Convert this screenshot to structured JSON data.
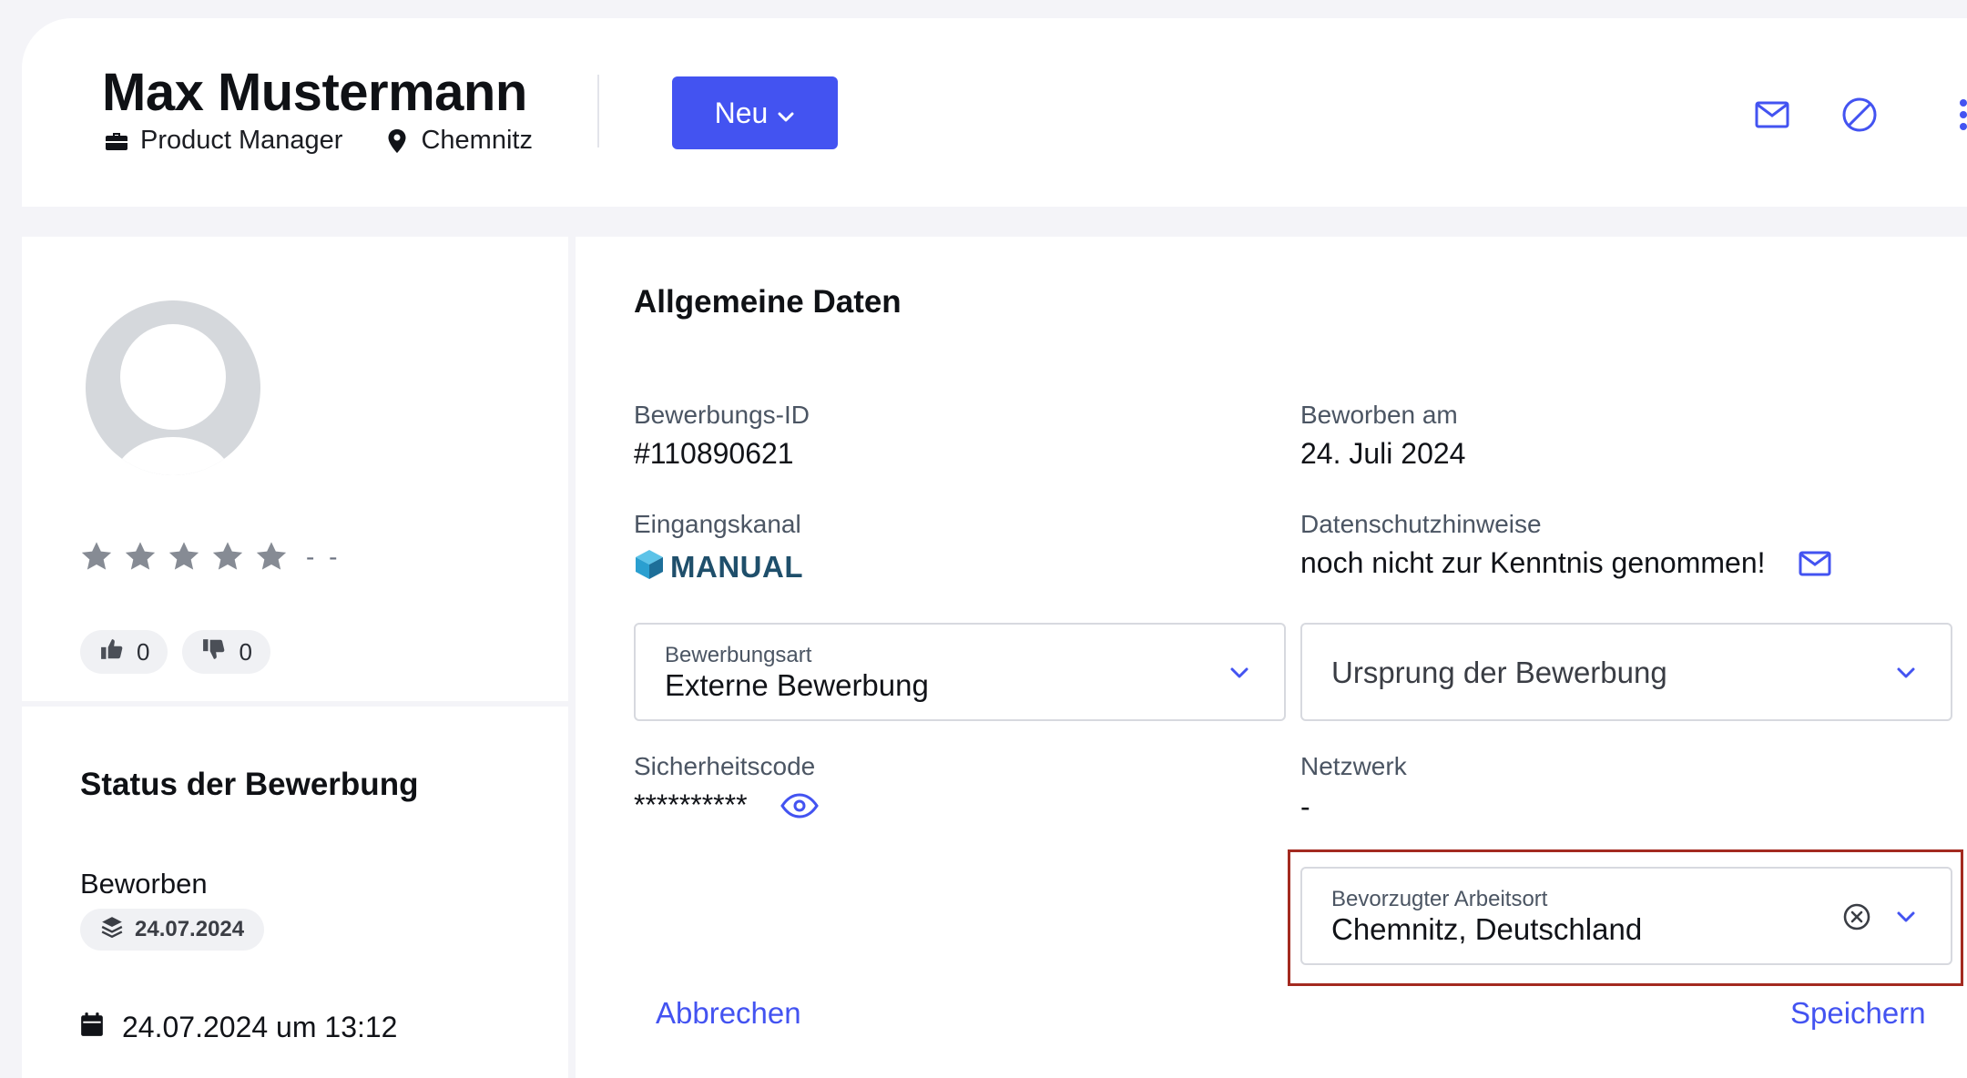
{
  "header": {
    "name": "Max Mustermann",
    "job_title": "Product Manager",
    "location": "Chemnitz",
    "new_button_label": "Neu",
    "accent_color": "#4353f1"
  },
  "profile": {
    "rating": 0,
    "rating_text": "- -",
    "thumbs_up": "0",
    "thumbs_down": "0"
  },
  "status": {
    "title": "Status der Bewerbung",
    "name": "Beworben",
    "badge_date": "24.07.2024",
    "timestamp": "24.07.2024 um 13:12"
  },
  "main": {
    "section_title": "Allgemeine Daten",
    "fields": {
      "application_id_label": "Bewerbungs-ID",
      "application_id_value": "#110890621",
      "applied_on_label": "Beworben am",
      "applied_on_value": "24. Juli 2024",
      "channel_label": "Eingangskanal",
      "channel_value": "MANUAL",
      "privacy_label": "Datenschutzhinweise",
      "privacy_value": "noch nicht zur Kenntnis genommen!",
      "security_code_label": "Sicherheitscode",
      "security_code_value": "**********",
      "network_label": "Netzwerk",
      "network_value": "-"
    },
    "application_type": {
      "label": "Bewerbungsart",
      "value": "Externe Bewerbung"
    },
    "origin": {
      "placeholder": "Ursprung der Bewerbung"
    },
    "preferred_location": {
      "label": "Bevorzugter Arbeitsort",
      "value": "Chemnitz, Deutschland"
    },
    "cancel_label": "Abbrechen",
    "save_label": "Speichern"
  },
  "icons": [
    "briefcase-icon",
    "location-pin-icon",
    "chevron-down-icon",
    "mail-icon",
    "block-icon",
    "more-vertical-icon",
    "star-icon",
    "thumbs-up-icon",
    "thumbs-down-icon",
    "layers-icon",
    "calendar-icon",
    "cube-icon",
    "eye-icon",
    "clear-icon"
  ]
}
